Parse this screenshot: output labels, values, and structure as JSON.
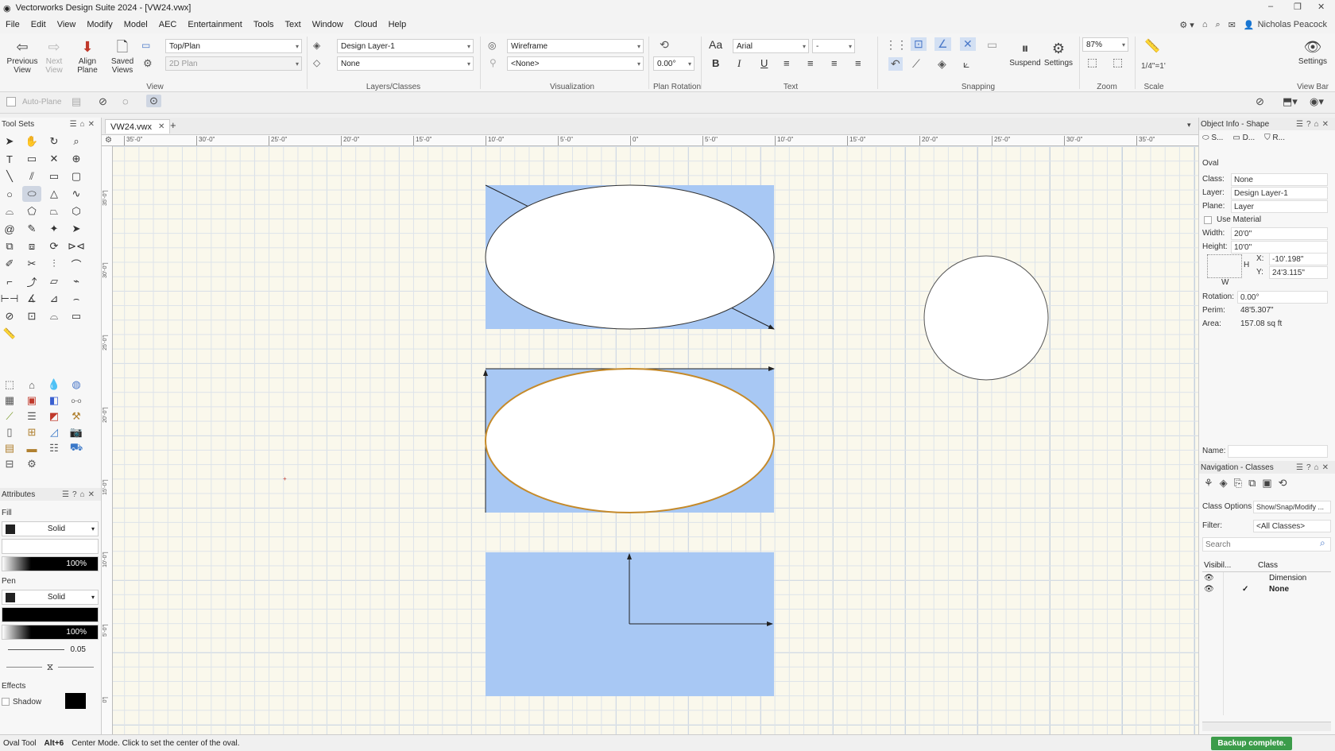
{
  "window": {
    "title": "Vectorworks Design Suite 2024 - [VW24.vwx]"
  },
  "menu": [
    "File",
    "Edit",
    "View",
    "Modify",
    "Model",
    "AEC",
    "Entertainment",
    "Tools",
    "Text",
    "Window",
    "Cloud",
    "Help"
  ],
  "user": {
    "name": "Nicholas Peacock"
  },
  "ribbon": {
    "previous_view": "Previous View",
    "next_view": "Next View",
    "align_plane": "Align Plane",
    "saved_views": "Saved Views",
    "view_select": "Top/Plan",
    "render_select": "2D Plan",
    "view_group": "View",
    "layer_select": "Design Layer-1",
    "class_select": "None",
    "layers_group": "Layers/Classes",
    "render_mode": "Wireframe",
    "light_select": "<None>",
    "vis_group": "Visualization",
    "rotation_value": "0.00°",
    "rotation_group": "Plan Rotation",
    "font_name": "Arial",
    "font_size": "-",
    "text_group": "Text",
    "snap_group": "Snapping",
    "suspend": "Suspend",
    "settings": "Settings",
    "zoom_value": "87%",
    "zoom_group": "Zoom",
    "scale_value": "1/4\"=1'",
    "scale_group": "Scale",
    "viewbar_settings": "Settings",
    "viewbar_group": "View Bar"
  },
  "context_bar": {
    "auto_plane": "Auto-Plane"
  },
  "toolsets": {
    "title": "Tool Sets"
  },
  "attributes": {
    "title": "Attributes",
    "fill_label": "Fill",
    "fill_style": "Solid",
    "fill_opacity": "100%",
    "pen_label": "Pen",
    "pen_style": "Solid",
    "pen_opacity": "100%",
    "line_weight": "0.05",
    "effects_label": "Effects",
    "shadow_label": "Shadow"
  },
  "document": {
    "tab": "VW24.vwx"
  },
  "rulers": {
    "top": [
      "35'-0\"",
      "30'-0\"",
      "25'-0\"",
      "20'-0\"",
      "15'-0\"",
      "10'-0\"",
      "5'-0\"",
      "0\"",
      "5'-0\"",
      "10'-0\"",
      "15'-0\"",
      "20'-0\"",
      "25'-0\"",
      "30'-0\"",
      "35'-0\""
    ],
    "left": [
      "35'-0\"",
      "30'-0\"",
      "25'-0\"",
      "20'-0\"",
      "15'-0\"",
      "10'-0\"",
      "5'-0\"",
      "0\""
    ]
  },
  "object_info": {
    "title": "Object Info - Shape",
    "tabs": [
      "S...",
      "D...",
      "R..."
    ],
    "object_type": "Oval",
    "class_label": "Class:",
    "class_value": "None",
    "layer_label": "Layer:",
    "layer_value": "Design Layer-1",
    "plane_label": "Plane:",
    "plane_value": "Layer",
    "use_material": "Use Material",
    "width_label": "Width:",
    "width_value": "20'0\"",
    "height_label": "Height:",
    "height_value": "10'0\"",
    "x_label": "X:",
    "x_value": "-10'.198\"",
    "y_label": "Y:",
    "y_value": "24'3.115\"",
    "h_label": "H",
    "w_label": "W",
    "rotation_label": "Rotation:",
    "rotation_value": "0.00°",
    "perim_label": "Perim:",
    "perim_value": "48'5.307\"",
    "area_label": "Area:",
    "area_value": "157.08 sq ft",
    "name_label": "Name:"
  },
  "navigation": {
    "title": "Navigation - Classes",
    "class_options_label": "Class Options",
    "class_options_value": "Show/Snap/Modify ...",
    "filter_label": "Filter:",
    "filter_value": "<All Classes>",
    "search_placeholder": "Search",
    "col_visibility": "Visibil...",
    "col_class": "Class",
    "rows": [
      "Dimension",
      "None"
    ]
  },
  "status": {
    "tool": "Oval Tool",
    "shortcut": "Alt+6",
    "hint": "Center Mode. Click to set the center of the oval.",
    "backup": "Backup complete."
  },
  "colors": {
    "selection": "#a8c8f4",
    "accent": "#3c9c4a",
    "highlight_oval": "#c58a2a"
  }
}
